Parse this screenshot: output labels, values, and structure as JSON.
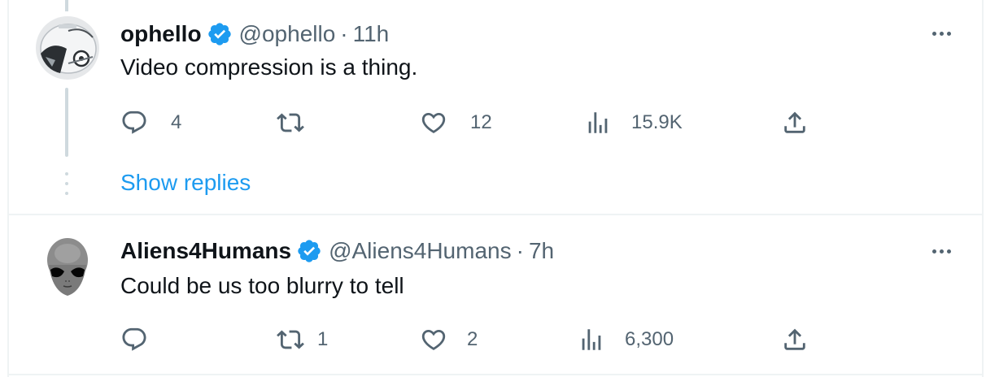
{
  "tweets": [
    {
      "display_name": "ophello",
      "handle": "@ophello",
      "separator": "·",
      "time": "11h",
      "text": "Video compression is a thing.",
      "counts": {
        "replies": "4",
        "retweets": "",
        "likes": "12",
        "views": "15.9K"
      },
      "avatar_icon": "astronaut-helmet-avatar"
    },
    {
      "display_name": "Aliens4Humans",
      "handle": "@Aliens4Humans",
      "separator": "·",
      "time": "7h",
      "text": "Could be us too blurry to tell",
      "counts": {
        "replies": "",
        "retweets": "1",
        "likes": "2",
        "views": "6,300"
      },
      "avatar_icon": "alien-head-avatar"
    }
  ],
  "show_replies": "Show replies",
  "colors": {
    "accent": "#1d9bf0",
    "text_primary": "#0f1419",
    "text_secondary": "#536471",
    "border": "#eff3f4",
    "thread_line": "#cfd9de"
  }
}
